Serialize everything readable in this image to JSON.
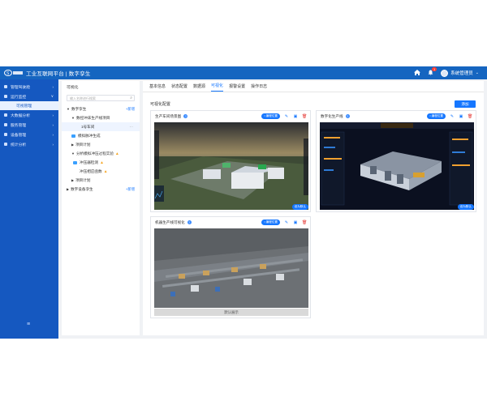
{
  "header": {
    "brand": "工业互联网平台 | 数字孪生",
    "notification_count": "1",
    "user": "系统管理员"
  },
  "sidebar": {
    "items": [
      {
        "label": "管理驾驶舱",
        "arrow": "›"
      },
      {
        "label": "运行监控",
        "arrow": "∨"
      },
      {
        "label": "大数据分析",
        "arrow": "›"
      },
      {
        "label": "服务管理",
        "arrow": "›"
      },
      {
        "label": "设备管理",
        "arrow": "›"
      },
      {
        "label": "统计分析",
        "arrow": "›"
      }
    ],
    "sub_active": "可视管理",
    "collapse_icon": "≡"
  },
  "tree": {
    "title": "可视化",
    "search_placeholder": "输入名称进行搜索",
    "nodes": [
      {
        "label": "数字孪生",
        "add": "+新增"
      },
      {
        "label": "数控冲床生产线项目"
      },
      {
        "label": "1号车间"
      },
      {
        "label": "模拟脉冲生成"
      },
      {
        "label": "项目计划"
      },
      {
        "label": "分析模拟冲压过程实验"
      },
      {
        "label": "冲压器检测"
      },
      {
        "label": "冲压相应函数"
      },
      {
        "label": "项目计划"
      },
      {
        "label": "数字设备孪生",
        "add": "+新增"
      }
    ]
  },
  "main": {
    "tabs": [
      "基本信息",
      "状态配置",
      "数据源",
      "可视化",
      "报警设置",
      "操作日志"
    ],
    "active_tab": "可视化",
    "section_title": "可视化配置",
    "add_button": "添加",
    "cards": [
      {
        "title": "生产车间场景图",
        "tag": "•  编程位置",
        "default_tag": "设为默认"
      },
      {
        "title": "数字化生产线",
        "tag": "•  编程位置",
        "default_tag": "设为默认"
      },
      {
        "title": "机器生产线可视化",
        "tag": "•  编程位置",
        "default_label": "默认展示"
      }
    ]
  },
  "colors": {
    "header_blue": "#1565c0",
    "sidebar_blue": "#1558c0",
    "accent": "#1677ff"
  }
}
